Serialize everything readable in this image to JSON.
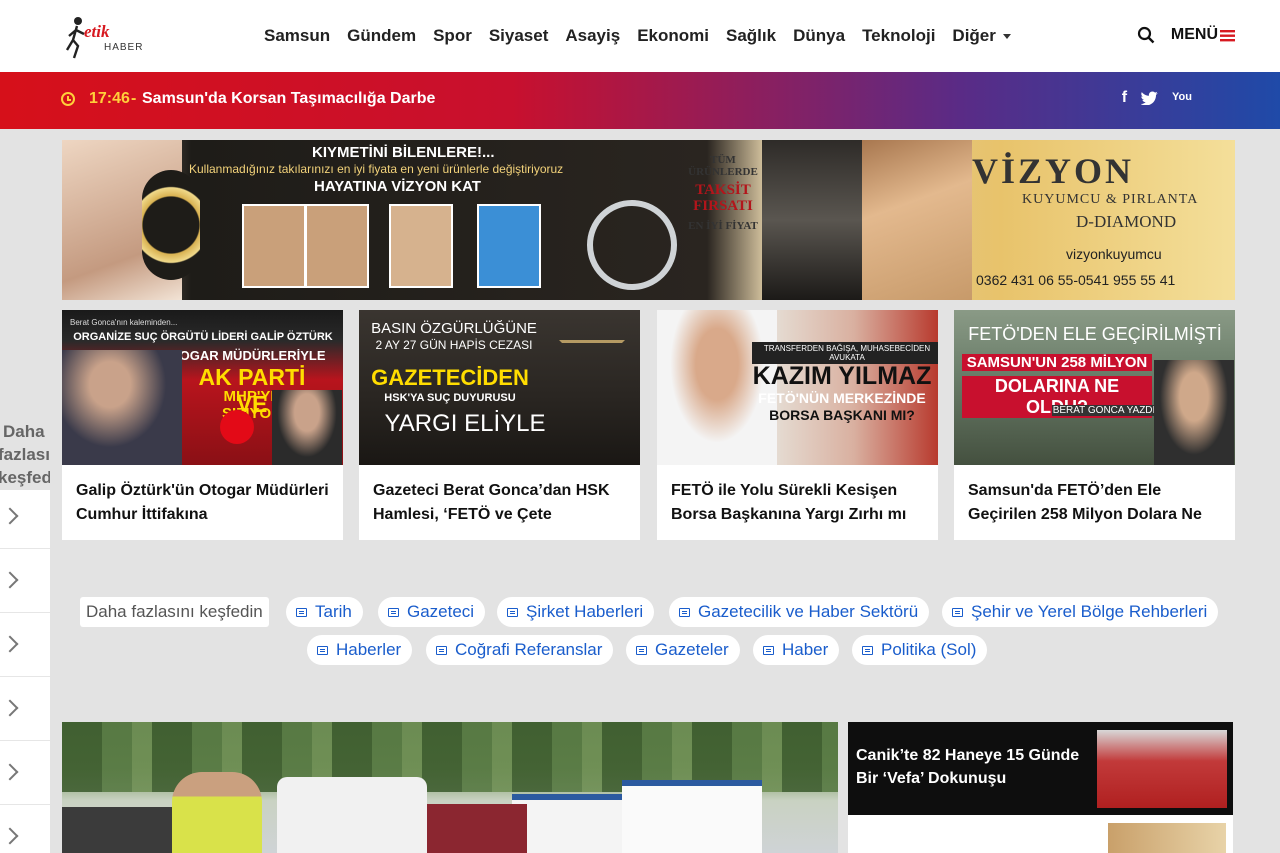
{
  "header": {
    "logo_text": "etik",
    "logo_sub": "HABER",
    "nav": [
      "Samsun",
      "Gündem",
      "Spor",
      "Siyaset",
      "Asayiş",
      "Ekonomi",
      "Sağlık",
      "Dünya",
      "Teknoloji",
      "Diğer"
    ],
    "menu_label": "MENÜ"
  },
  "ticker": {
    "time": "17:46",
    "dash": "-",
    "title": "Samsun'da Korsan Taşımacılığa Darbe",
    "social": [
      "f",
      "t",
      "You"
    ]
  },
  "banner": {
    "headline": "KIYMETİNİ BİLENLERE!...",
    "sub": "Kullanmadığınız takılarınızı en iyi fiyata en yeni ürünlerle değiştiriyoruz",
    "cta": "HAYATINA VİZYON KAT",
    "promo_top": "TÜM ÜRÜNLERDE",
    "promo_main": "TAKSİT FIRSATI",
    "promo_bottom": "EN İYİ FİYAT",
    "brand": "VİZYON",
    "brand_sub": "KUYUMCU & PIRLANTA",
    "brand_diamond": "D-DIAMOND",
    "instagram": "vizyonkuyumcu",
    "phones": "0362 431 06 55-0541 955 55 41"
  },
  "cards": [
    {
      "title": "Galip Öztürk'ün Otogar Müdürleri Cumhur İttifakına",
      "overlay_small": "Berat Gonca'nın kaleminden...",
      "overlay_1": "ORGANİZE SUÇ ÖRGÜTÜ LİDERİ GALİP ÖZTÜRK",
      "overlay_2": "SAMSUN'DA OTOGAR MÜDÜRLERİYLE",
      "overlay_3": "AK PARTİ VE",
      "overlay_4": "MHP'YE SIZIYOR"
    },
    {
      "title": "Gazeteci Berat Gonca’dan HSK Hamlesi, ‘FETÖ ve Çete",
      "overlay_small": "BASIN ÖZGÜRLÜĞÜNE",
      "overlay_1": "2 AY 27 GÜN HAPİS CEZASI",
      "overlay_2": "GAZETECİDEN",
      "overlay_3": "HSK'YA SUÇ DUYURUSU",
      "overlay_4": "YARGI ELİYLE"
    },
    {
      "title": "FETÖ ile Yolu Sürekli Kesişen Borsa Başkanına Yargı Zırhı mı",
      "overlay_small": "TRANSFERDEN BAĞIŞA, MUHASEBECİDEN AVUKATA",
      "overlay_1": "KAZIM YILMAZ",
      "overlay_2": "FETÖ'NÜN MERKEZİNDE",
      "overlay_3": "BORSA BAŞKANI MI?",
      "overlay_4": ""
    },
    {
      "title": "Samsun'da FETÖ’den Ele Geçirilen 258 Milyon Dolara Ne",
      "overlay_small": "FETÖ'DEN ELE GEÇİRİLMİŞTİ",
      "overlay_1": "SAMSUN'UN 258 MİLYON",
      "overlay_2": "DOLARINA NE OLDU?",
      "overlay_3": "BERAT GONCA YAZDI",
      "overlay_4": ""
    }
  ],
  "explore": {
    "label": "Daha fazlasını keşfedin",
    "chips": [
      "Tarih",
      "Gazeteci",
      "Şirket Haberleri",
      "Gazetecilik ve Haber Sektörü",
      "Şehir ve Yerel Bölge Rehberleri",
      "Haberler",
      "Coğrafi Referanslar",
      "Gazeteler",
      "Haber",
      "Politika (Sol)"
    ]
  },
  "left_panel": {
    "line1": "Daha",
    "line2": "fazlasını",
    "line3": "keşfedin"
  },
  "side_news": [
    {
      "title": "Canik’te 82 Haneye 15 Günde Bir ‘Vefa’ Dokunuşu"
    }
  ],
  "colors": {
    "ticker_start": "#d6101a",
    "ticker_end": "#1f4aa8",
    "accent": "#d71920",
    "chip_text": "#1a5dcc"
  }
}
